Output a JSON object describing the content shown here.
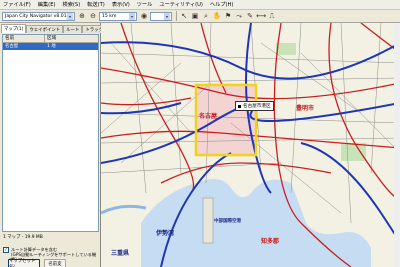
{
  "menubar": {
    "items": [
      {
        "label": "ファイル(F)"
      },
      {
        "label": "編集(E)"
      },
      {
        "label": "検索(S)"
      },
      {
        "label": "転送(T)"
      },
      {
        "label": "表示(V)"
      },
      {
        "label": "ツール"
      },
      {
        "label": "ユーティリティ(U)"
      },
      {
        "label": "ヘルプ(H)"
      }
    ]
  },
  "toolbar": {
    "map_select": "Japan City Navigator v8.01",
    "scale_select": "15 km"
  },
  "tabs": [
    {
      "label": "マップ(1)",
      "active": true
    },
    {
      "label": "ウェイポイント"
    },
    {
      "label": "ルート"
    },
    {
      "label": "トラック"
    }
  ],
  "list": {
    "col_name": "名前",
    "col_area": "区域",
    "rows": [
      {
        "name": "名古屋",
        "area": "1 地"
      }
    ]
  },
  "status": "1 マップ - 19.9 MB",
  "checkbox": {
    "checked": true,
    "label_line1": "ルート計算データを含む",
    "label_line2": "(GPS自動ルーティングをサポートしている機種)"
  },
  "buttons": {
    "send_map": "マップセット名(",
    "name_change": "名前変"
  },
  "map": {
    "popup": "名古屋市港区",
    "labels": [
      {
        "text": "名古屋",
        "cls": "red"
      },
      {
        "text": "豊明市",
        "cls": "red"
      },
      {
        "text": "中部国際空港",
        "cls": "blue"
      },
      {
        "text": "伊勢湾",
        "cls": "blue"
      },
      {
        "text": "三重県",
        "cls": "blue"
      },
      {
        "text": "知多郡",
        "cls": "red"
      }
    ]
  }
}
